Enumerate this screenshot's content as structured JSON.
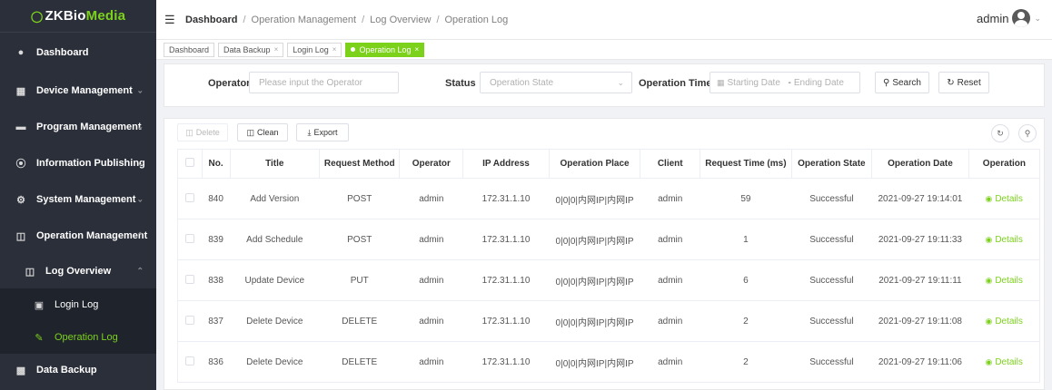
{
  "app": {
    "brand_prefix": "ZKBio",
    "brand_suffix": "Media",
    "accent_color": "#7cd21b"
  },
  "sidebar": {
    "items": [
      {
        "label": "Dashboard",
        "icon": "dashboard-icon"
      },
      {
        "label": "Device Management",
        "icon": "device-icon"
      },
      {
        "label": "Program Management",
        "icon": "folder-icon"
      },
      {
        "label": "Information Publishing",
        "icon": "publish-icon"
      },
      {
        "label": "System Management",
        "icon": "gear-icon"
      },
      {
        "label": "Operation Management",
        "icon": "monitor-icon"
      },
      {
        "label": "Log Overview",
        "icon": "log-icon"
      },
      {
        "label": "Login Log",
        "icon": "login-log-icon"
      },
      {
        "label": "Operation Log",
        "icon": "operation-log-icon"
      },
      {
        "label": "Data Backup",
        "icon": "backup-icon"
      }
    ]
  },
  "header": {
    "breadcrumb": [
      "Dashboard",
      "Operation Management",
      "Log Overview",
      "Operation Log"
    ],
    "user": "admin"
  },
  "tabs": [
    {
      "label": "Dashboard"
    },
    {
      "label": "Data Backup"
    },
    {
      "label": "Login Log"
    },
    {
      "label": "Operation Log",
      "active": true
    }
  ],
  "filter": {
    "operator_label": "Operator",
    "operator_placeholder": "Please input the Operator",
    "status_label": "Status",
    "status_placeholder": "Operation State",
    "time_label": "Operation Time",
    "start_placeholder": "Starting Date",
    "end_placeholder": "Ending Date",
    "range_sep": "-",
    "search_label": "Search",
    "reset_label": "Reset"
  },
  "toolbar": {
    "delete_label": "Delete",
    "clean_label": "Clean",
    "export_label": "Export"
  },
  "table": {
    "columns": [
      "No.",
      "Title",
      "Request Method",
      "Operator",
      "IP Address",
      "Operation Place",
      "Client",
      "Request Time (ms)",
      "Operation State",
      "Operation Date",
      "Operation"
    ],
    "details_label": "Details",
    "rows": [
      {
        "no": "840",
        "title": "Add Version",
        "method": "POST",
        "operator": "admin",
        "ip": "172.31.1.10",
        "place": "0|0|0|内网IP|内网IP",
        "client": "admin",
        "time": "59",
        "state": "Successful",
        "date": "2021-09-27 19:14:01"
      },
      {
        "no": "839",
        "title": "Add Schedule",
        "method": "POST",
        "operator": "admin",
        "ip": "172.31.1.10",
        "place": "0|0|0|内网IP|内网IP",
        "client": "admin",
        "time": "1",
        "state": "Successful",
        "date": "2021-09-27 19:11:33"
      },
      {
        "no": "838",
        "title": "Update Device",
        "method": "PUT",
        "operator": "admin",
        "ip": "172.31.1.10",
        "place": "0|0|0|内网IP|内网IP",
        "client": "admin",
        "time": "6",
        "state": "Successful",
        "date": "2021-09-27 19:11:11"
      },
      {
        "no": "837",
        "title": "Delete Device",
        "method": "DELETE",
        "operator": "admin",
        "ip": "172.31.1.10",
        "place": "0|0|0|内网IP|内网IP",
        "client": "admin",
        "time": "2",
        "state": "Successful",
        "date": "2021-09-27 19:11:08"
      },
      {
        "no": "836",
        "title": "Delete Device",
        "method": "DELETE",
        "operator": "admin",
        "ip": "172.31.1.10",
        "place": "0|0|0|内网IP|内网IP",
        "client": "admin",
        "time": "2",
        "state": "Successful",
        "date": "2021-09-27 19:11:06"
      }
    ]
  }
}
